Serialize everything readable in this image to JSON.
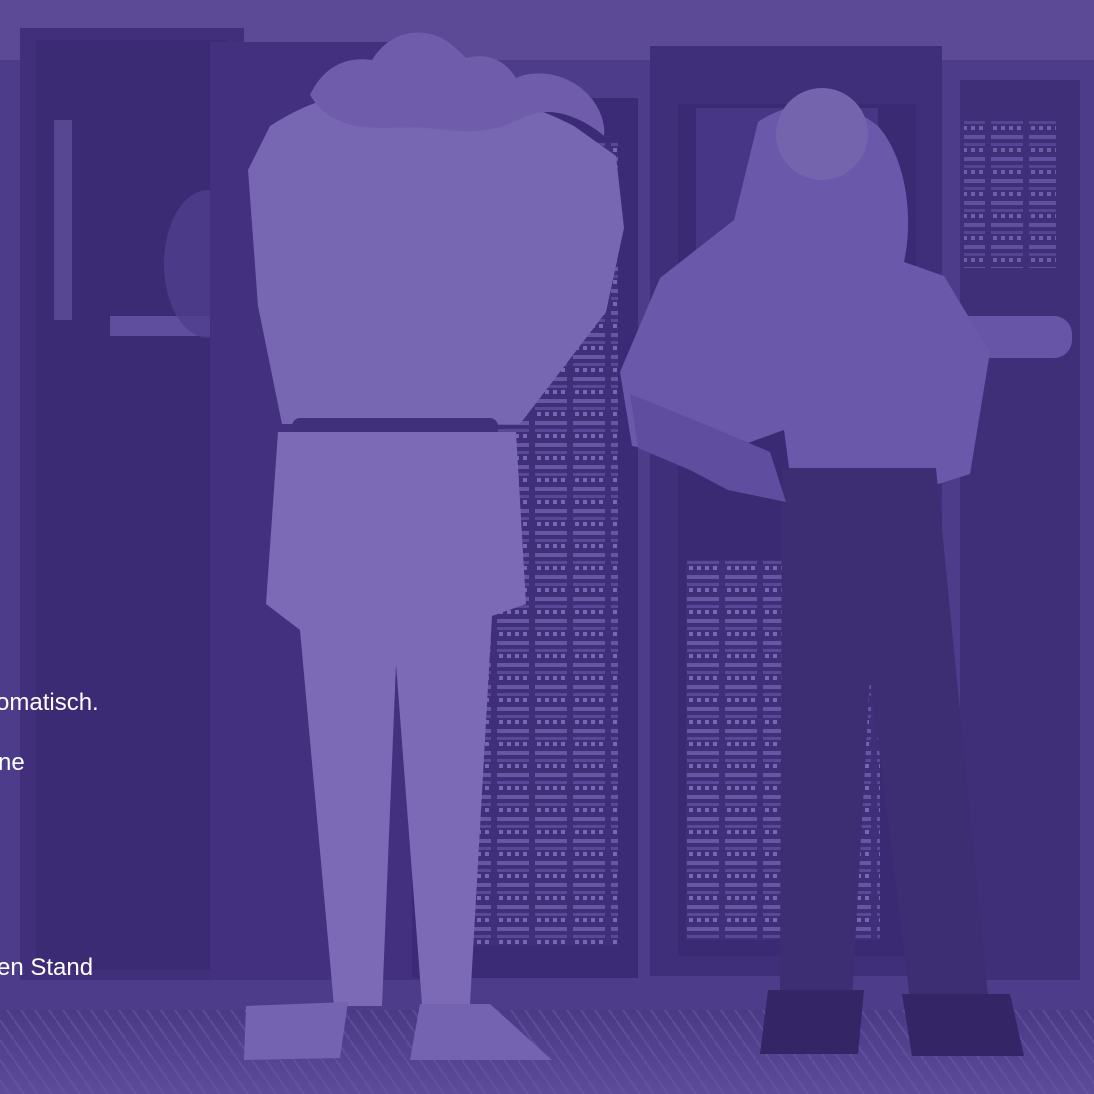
{
  "photo": {
    "subject": "two-men-in-server-room-photo",
    "tint_color": "#5b4897"
  },
  "overlay": {
    "line_1": "omatisch.",
    "line_2": "ne",
    "line_3": "en Stand"
  }
}
